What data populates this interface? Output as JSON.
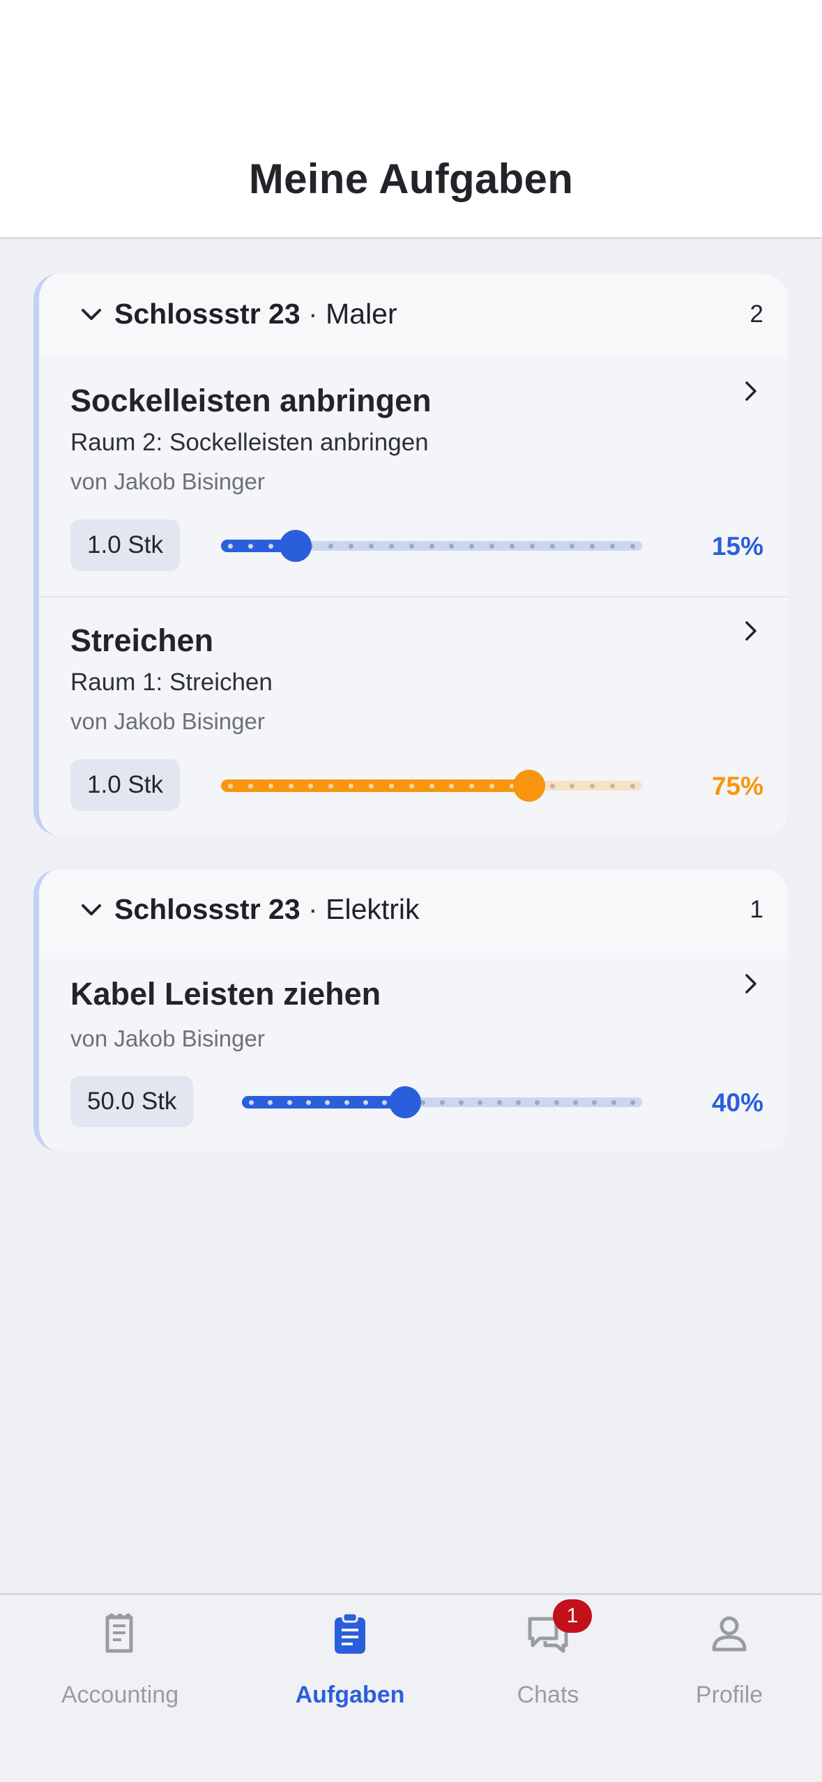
{
  "header": {
    "title": "Meine Aufgaben"
  },
  "groups": [
    {
      "location": "Schlossstr 23",
      "separator": "·",
      "trade": "Maler",
      "count": "2",
      "tasks": [
        {
          "title": "Sockelleisten anbringen",
          "description": "Raum 2: Sockelleisten anbringen",
          "author": "von Jakob Bisinger",
          "quantity": "1.0 Stk",
          "progress": 0.15,
          "progress_label": "15%",
          "color": "blue"
        },
        {
          "title": "Streichen",
          "description": "Raum 1: Streichen",
          "author": "von Jakob Bisinger",
          "quantity": "1.0 Stk",
          "progress": 0.75,
          "progress_label": "75%",
          "color": "orange"
        }
      ]
    },
    {
      "location": "Schlossstr 23",
      "separator": "·",
      "trade": "Elektrik",
      "count": "1",
      "tasks": [
        {
          "title": "Kabel Leisten ziehen",
          "author": "von Jakob Bisinger",
          "quantity": "50.0 Stk",
          "progress": 0.4,
          "progress_label": "40%",
          "color": "blue"
        }
      ]
    }
  ],
  "tabbar": {
    "tabs": [
      {
        "label": "Accounting",
        "icon": "receipt-icon",
        "active": false
      },
      {
        "label": "Aufgaben",
        "icon": "clipboard-icon",
        "active": true
      },
      {
        "label": "Chats",
        "icon": "chat-bubbles-icon",
        "active": false,
        "badge": "1"
      },
      {
        "label": "Profile",
        "icon": "person-icon",
        "active": false
      }
    ]
  },
  "colors": {
    "accent_blue": "#2a5fdc",
    "accent_orange": "#f7960e",
    "badge_red": "#c4101a"
  }
}
